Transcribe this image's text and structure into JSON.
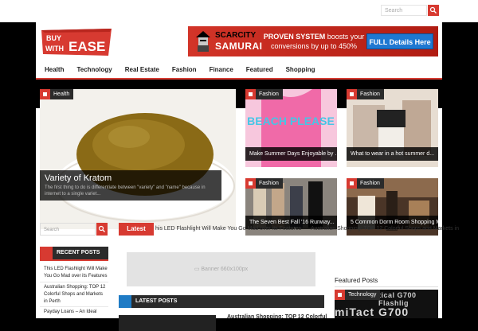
{
  "topbar": {
    "search_placeholder": "Search"
  },
  "logo": {
    "line1": "BUY",
    "line2": "WITH",
    "line3": "EASE"
  },
  "ad_banner": {
    "brand_top": "SCARCITY",
    "brand_bottom": "SAMURAI",
    "pitch_bold": "PROVEN SYSTEM",
    "pitch_rest": " boosts your conversions by up to 450%",
    "cta": "FULL Details Here"
  },
  "nav": {
    "items": [
      "Health",
      "Technology",
      "Real Estate",
      "Fashion",
      "Finance",
      "Featured",
      "Shopping"
    ]
  },
  "featured_big": {
    "tag": "Health",
    "title": "Variety of Kratom",
    "excerpt": "The first thing to do is differentiate between \"variety\" and \"name\" because in internet to a single variet..."
  },
  "tiles": [
    {
      "tag": "Fashion",
      "caption": "Make Summer Days Enjoyable by ...",
      "color": "#f06aa8",
      "shirt_text": "BEACH PLEASE"
    },
    {
      "tag": "Fashion",
      "caption": "What to wear in a hot summer d...",
      "color": "#d9c7b8"
    },
    {
      "tag": "Fashion",
      "caption": "The Seven Best Fall '16 Runway...",
      "color": "#6f6a64"
    },
    {
      "tag": "Fashion",
      "caption": "5 Common Dorm Room Shopping Mi...",
      "color": "#7a5a3f"
    }
  ],
  "sidebar": {
    "search_placeholder": "Search",
    "recent_posts_label": "RECENT POSTS",
    "recent_posts": [
      "This LED Flashlight Will Make You Go Mad over its Features",
      "Australian Shopping: TOP 12 Colorful Shops and Markets in Perth",
      "Payday Loans – An Ideal"
    ]
  },
  "latest_news": {
    "label": "Latest News",
    "ticker": [
      "his LED Flashlight Will Make You Go Mad over its Features",
      "Australian Shopping: TOP 12 Colorful Shops and Markets in"
    ],
    "separator": "›"
  },
  "banner_placeholder": "Banner 660x100px",
  "latest_posts": {
    "label": "LATEST POSTS",
    "first_title": "Australian Shopping: TOP 12 Colorful"
  },
  "featured_posts": {
    "label": "Featured Posts",
    "tag": "Technology",
    "img_text1": "tical G700 Flashlig",
    "img_text2": "miTact G700"
  },
  "colors": {
    "accent": "#d73a31",
    "dark": "#2b2b2b",
    "blue": "#1f7bc5"
  }
}
